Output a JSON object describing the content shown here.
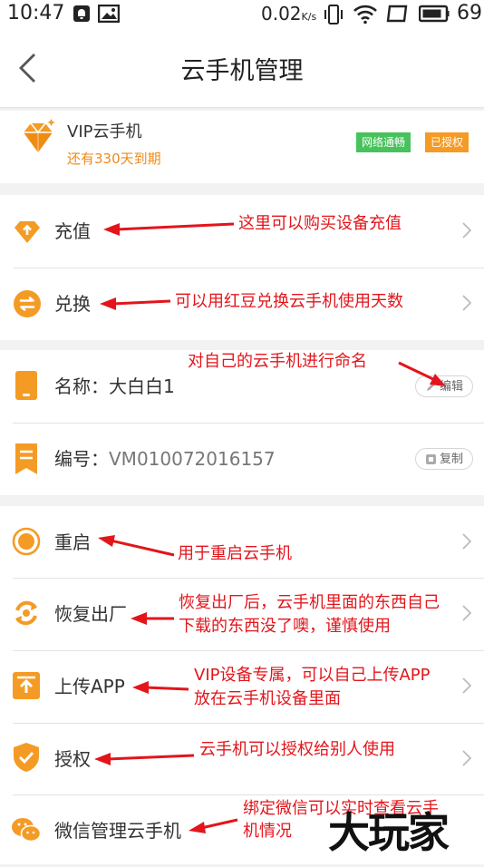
{
  "status_bar": {
    "time": "10:47",
    "network_speed": "0.02",
    "network_speed_unit": "K/s",
    "battery_level": "69"
  },
  "nav": {
    "title": "云手机管理"
  },
  "vip": {
    "title": "VIP云手机",
    "expiry": "还有330天到期",
    "tag_network": "网络通畅",
    "tag_authorized": "已授权"
  },
  "rows": {
    "recharge": "充值",
    "exchange": "兑换",
    "name_label": "名称：",
    "name_value": "大白白1",
    "edit_button": "编辑",
    "number_label": "编号：",
    "number_value": "VM010072016157",
    "copy_button": "复制",
    "restart": "重启",
    "factory_reset": "恢复出厂",
    "upload_app": "上传APP",
    "authorize": "授权",
    "wechat_manage": "微信管理云手机"
  },
  "annotations": {
    "recharge": "这里可以购买设备充值",
    "exchange": "可以用红豆兑换云手机使用天数",
    "rename": "对自己的云手机进行命名",
    "restart": "用于重启云手机",
    "reset_line1": "恢复出厂后，云手机里面的东西自己",
    "reset_line2": "下载的东西没了噢，谨慎使用",
    "upload_line1": "VIP设备专属，可以自己上传APP",
    "upload_line2": "放在云手机设备里面",
    "authorize": "云手机可以授权给别人使用",
    "wechat_line1": "绑定微信可以实时查看云手",
    "wechat_line2": "机情况"
  },
  "watermark": "大玩家",
  "colors": {
    "accent_orange": "#f49b25",
    "annotation_red": "#e3151b",
    "tag_green": "#47c25c"
  },
  "icons": [
    "bell-icon",
    "image-icon",
    "vibrate-icon",
    "wifi-icon",
    "window-icon",
    "battery-icon",
    "back-arrow-icon",
    "diamond-icon",
    "chevron-right-icon",
    "phone-icon",
    "bookmark-icon",
    "record-icon",
    "refresh-icon",
    "upload-icon",
    "shield-check-icon",
    "wechat-icon"
  ]
}
